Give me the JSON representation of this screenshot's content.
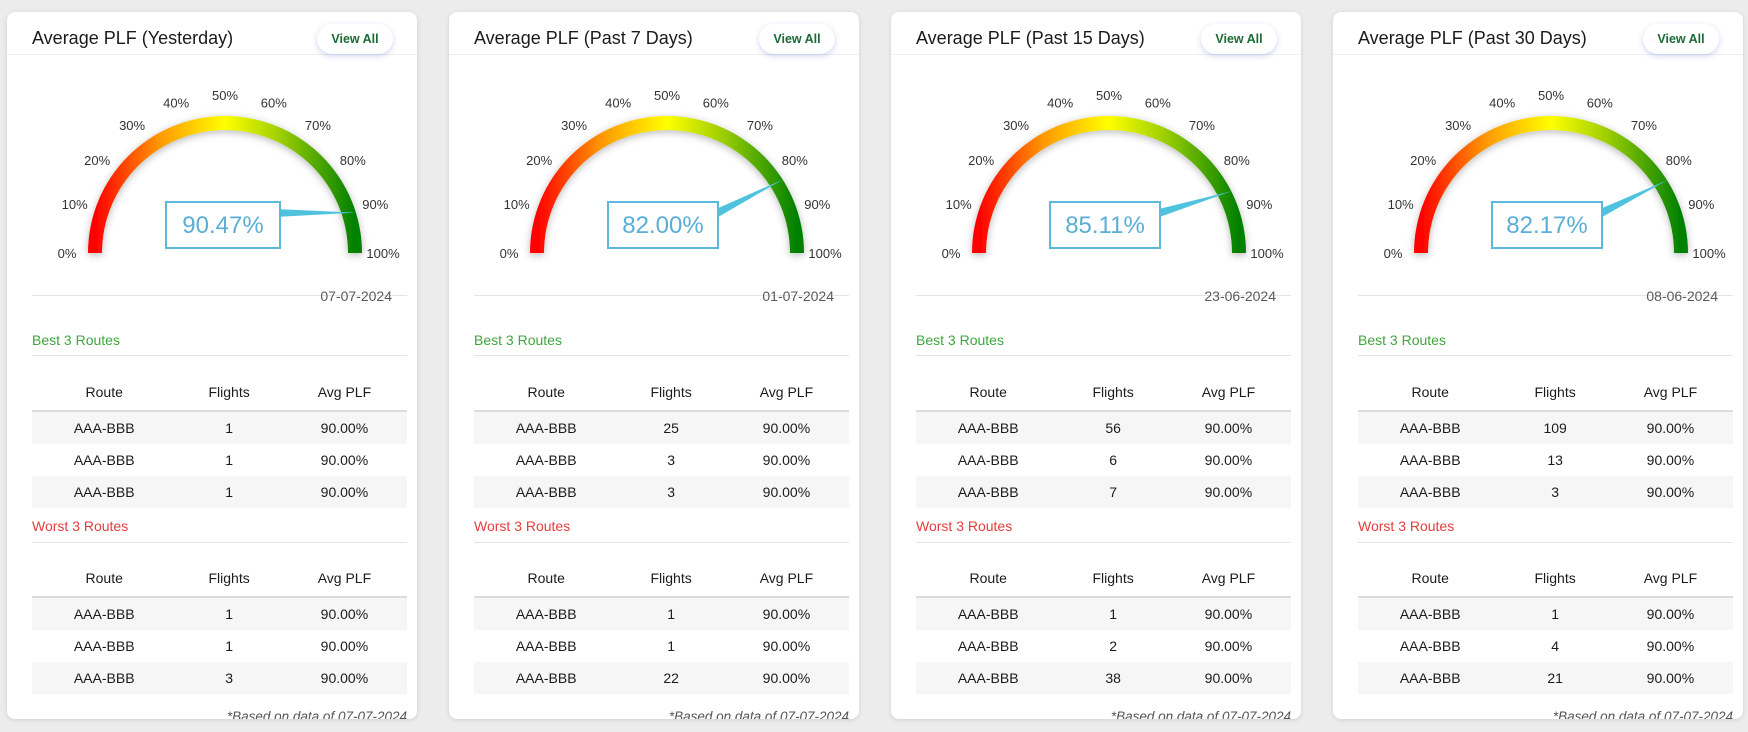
{
  "view_all_label": "View All",
  "best_title": "Best 3 Routes",
  "worst_title": "Worst 3 Routes",
  "table_headers": {
    "route": "Route",
    "flights": "Flights",
    "avg_plf": "Avg PLF"
  },
  "gauge_tick_labels": [
    "0%",
    "10%",
    "20%",
    "30%",
    "40%",
    "50%",
    "60%",
    "70%",
    "80%",
    "90%",
    "100%"
  ],
  "gauge_colors": {
    "low": "#ff0000",
    "mid_low": "#ff9900",
    "mid": "#ffff00",
    "mid_high": "#9acd00",
    "high": "#008000",
    "needle": "#4fc3dd"
  },
  "cards": [
    {
      "title": "Average PLF (Yesterday)",
      "value_percent": 90.47,
      "value_text": "90.47%",
      "date": "07-07-2024",
      "best": [
        {
          "route": "AAA-BBB",
          "flights": "1",
          "avg_plf": "90.00%"
        },
        {
          "route": "AAA-BBB",
          "flights": "1",
          "avg_plf": "90.00%"
        },
        {
          "route": "AAA-BBB",
          "flights": "1",
          "avg_plf": "90.00%"
        }
      ],
      "worst": [
        {
          "route": "AAA-BBB",
          "flights": "1",
          "avg_plf": "90.00%"
        },
        {
          "route": "AAA-BBB",
          "flights": "1",
          "avg_plf": "90.00%"
        },
        {
          "route": "AAA-BBB",
          "flights": "3",
          "avg_plf": "90.00%"
        }
      ],
      "footnote": "*Based on data of 07-07-2024"
    },
    {
      "title": "Average PLF (Past 7 Days)",
      "value_percent": 82.0,
      "value_text": "82.00%",
      "date": "01-07-2024",
      "best": [
        {
          "route": "AAA-BBB",
          "flights": "25",
          "avg_plf": "90.00%"
        },
        {
          "route": "AAA-BBB",
          "flights": "3",
          "avg_plf": "90.00%"
        },
        {
          "route": "AAA-BBB",
          "flights": "3",
          "avg_plf": "90.00%"
        }
      ],
      "worst": [
        {
          "route": "AAA-BBB",
          "flights": "1",
          "avg_plf": "90.00%"
        },
        {
          "route": "AAA-BBB",
          "flights": "1",
          "avg_plf": "90.00%"
        },
        {
          "route": "AAA-BBB",
          "flights": "22",
          "avg_plf": "90.00%"
        }
      ],
      "footnote": "*Based on data of 07-07-2024"
    },
    {
      "title": "Average PLF (Past 15 Days)",
      "value_percent": 85.11,
      "value_text": "85.11%",
      "date": "23-06-2024",
      "best": [
        {
          "route": "AAA-BBB",
          "flights": "56",
          "avg_plf": "90.00%"
        },
        {
          "route": "AAA-BBB",
          "flights": "6",
          "avg_plf": "90.00%"
        },
        {
          "route": "AAA-BBB",
          "flights": "7",
          "avg_plf": "90.00%"
        }
      ],
      "worst": [
        {
          "route": "AAA-BBB",
          "flights": "1",
          "avg_plf": "90.00%"
        },
        {
          "route": "AAA-BBB",
          "flights": "2",
          "avg_plf": "90.00%"
        },
        {
          "route": "AAA-BBB",
          "flights": "38",
          "avg_plf": "90.00%"
        }
      ],
      "footnote": "*Based on data of 07-07-2024"
    },
    {
      "title": "Average PLF (Past 30 Days)",
      "value_percent": 82.17,
      "value_text": "82.17%",
      "date": "08-06-2024",
      "best": [
        {
          "route": "AAA-BBB",
          "flights": "109",
          "avg_plf": "90.00%"
        },
        {
          "route": "AAA-BBB",
          "flights": "13",
          "avg_plf": "90.00%"
        },
        {
          "route": "AAA-BBB",
          "flights": "3",
          "avg_plf": "90.00%"
        }
      ],
      "worst": [
        {
          "route": "AAA-BBB",
          "flights": "1",
          "avg_plf": "90.00%"
        },
        {
          "route": "AAA-BBB",
          "flights": "4",
          "avg_plf": "90.00%"
        },
        {
          "route": "AAA-BBB",
          "flights": "21",
          "avg_plf": "90.00%"
        }
      ],
      "footnote": "*Based on data of 07-07-2024"
    }
  ]
}
